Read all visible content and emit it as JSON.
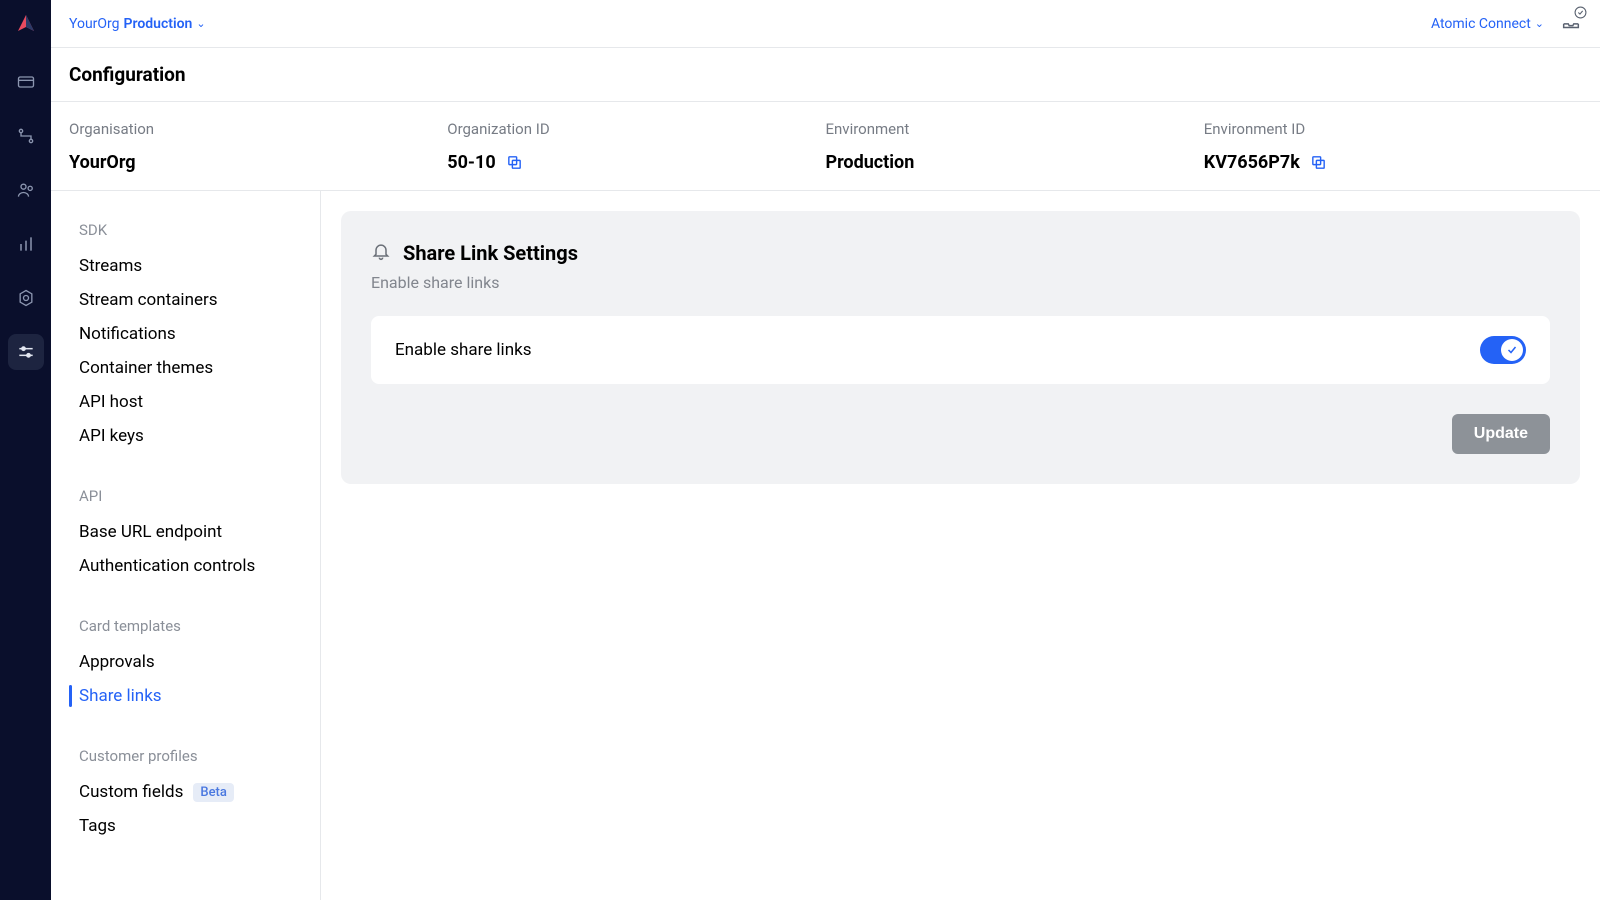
{
  "topbar": {
    "org_name": "YourOrg",
    "env_name": "Production",
    "connect_label": "Atomic Connect"
  },
  "page_title": "Configuration",
  "info": {
    "org_label": "Organisation",
    "org_value": "YourOrg",
    "orgid_label": "Organization ID",
    "orgid_value": "50-10",
    "env_label": "Environment",
    "env_value": "Production",
    "envid_label": "Environment ID",
    "envid_value": "KV7656P7k"
  },
  "sidebar": {
    "groups": [
      {
        "label": "SDK",
        "items": [
          {
            "label": "Streams"
          },
          {
            "label": "Stream containers"
          },
          {
            "label": "Notifications"
          },
          {
            "label": "Container themes"
          },
          {
            "label": "API host"
          },
          {
            "label": "API keys"
          }
        ]
      },
      {
        "label": "API",
        "items": [
          {
            "label": "Base URL endpoint"
          },
          {
            "label": "Authentication controls"
          }
        ]
      },
      {
        "label": "Card templates",
        "items": [
          {
            "label": "Approvals"
          },
          {
            "label": "Share links",
            "active": true
          }
        ]
      },
      {
        "label": "Customer profiles",
        "items": [
          {
            "label": "Custom fields",
            "badge": "Beta"
          },
          {
            "label": "Tags"
          }
        ]
      }
    ]
  },
  "panel": {
    "title": "Share Link Settings",
    "subtitle": "Enable share links",
    "setting_label": "Enable share links",
    "update_button": "Update"
  }
}
